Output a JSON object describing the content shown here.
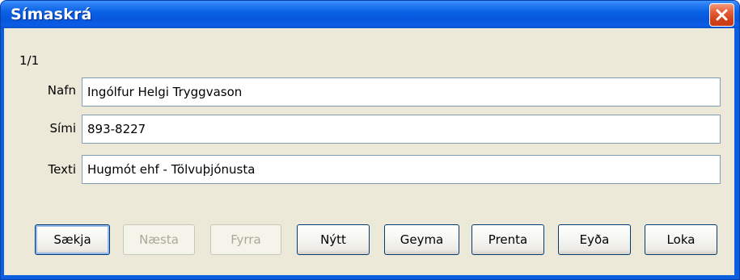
{
  "window": {
    "title": "Símaskrá",
    "accent_color": "#0a5fe0",
    "close_color": "#d9461e"
  },
  "record_counter": "1/1",
  "fields": {
    "name": {
      "label": "Nafn",
      "value": "Ingólfur Helgi Tryggvason"
    },
    "phone": {
      "label": "Sími",
      "value": "893-8227"
    },
    "text": {
      "label": "Texti",
      "value": "Hugmót ehf - Tölvuþjónusta"
    }
  },
  "buttons": {
    "fetch": {
      "label": "Sækja",
      "enabled": true
    },
    "next": {
      "label": "Næsta",
      "enabled": false
    },
    "prev": {
      "label": "Fyrra",
      "enabled": false
    },
    "new": {
      "label": "Nýtt",
      "enabled": true
    },
    "save": {
      "label": "Geyma",
      "enabled": true
    },
    "print": {
      "label": "Prenta",
      "enabled": true
    },
    "delete": {
      "label": "Eyða",
      "enabled": true
    },
    "close": {
      "label": "Loka",
      "enabled": true
    }
  },
  "icons": {
    "close": "close-x-icon"
  }
}
